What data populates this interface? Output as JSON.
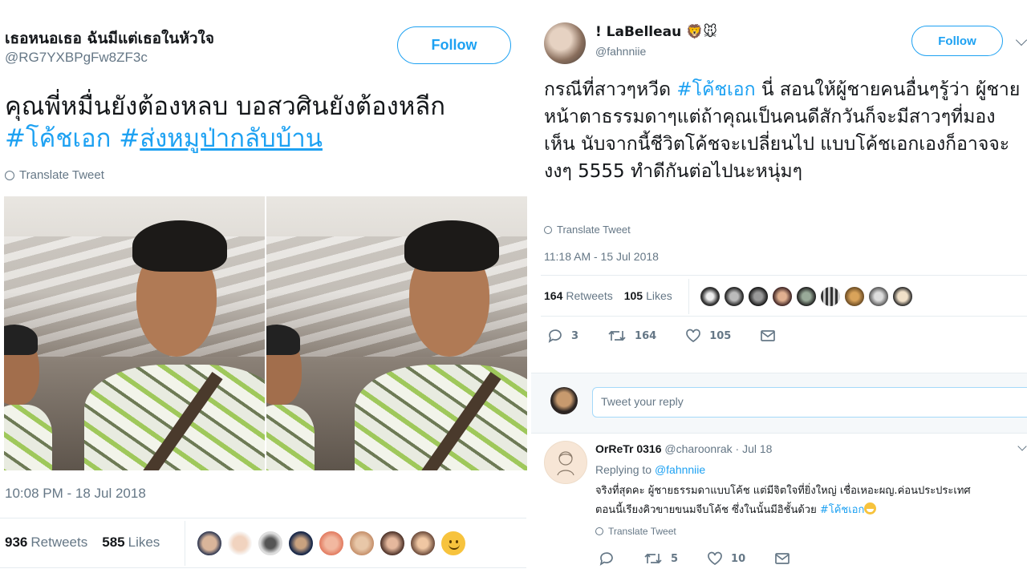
{
  "left_tweet": {
    "user_name": "เธอหนอเธอ ฉันมีแต่เธอในหัวใจ",
    "user_handle": "@RG7YXBPgFw8ZF3c",
    "follow_label": "Follow",
    "text_line1": "คุณพี่หมื่นยังต้องหลบ บอสวศินยังต้องหลีก",
    "hashtag1": "#โค้ชเอก",
    "hashtag2_prefix": "#",
    "hashtag2_link": "ส่งหมูป่ากลับบ้าน",
    "translate_label": "Translate Tweet",
    "timestamp": "10:08 PM - 18 Jul 2018",
    "retweets_count": "936",
    "retweets_label": "Retweets",
    "likes_count": "585",
    "likes_label": "Likes"
  },
  "right_tweet": {
    "user_name": "! LaBelleau 🦁🐭",
    "user_handle": "@fahnniie",
    "follow_label": "Follow",
    "text_before": "กรณีที่สาวๆหวีด ",
    "text_hashtag": "#โค้ชเอก",
    "text_after": " นี่ สอนให้ผู้ชายคนอื่นๆรู้ว่า ผู้ชายหน้าตาธรรมดาๆแต่ถ้าคุณเป็นคนดีสักวันก็จะมีสาวๆที่มองเห็น นับจากนี้ชีวิตโค้ชจะเปลี่ยนไป แบบโค้ชเอกเองก็อาจจะงงๆ 5555 ทำดีกันต่อไปนะหนุ่มๆ",
    "translate_label": "Translate Tweet",
    "timestamp": "11:18 AM - 15 Jul 2018",
    "retweets_count": "164",
    "retweets_label": "Retweets",
    "likes_count": "105",
    "likes_label": "Likes",
    "actions": {
      "reply_count": "3",
      "retweet_count": "164",
      "like_count": "105"
    }
  },
  "reply_box": {
    "placeholder": "Tweet your reply"
  },
  "reply": {
    "user_name": "OrReTr 0316",
    "user_handle": "@charoonrak",
    "date": "· Jul 18",
    "replying_prefix": "Replying to ",
    "replying_handle": "@fahnniie",
    "text_line1": "จริงที่สุดคะ ผู้ชายธรรมดาแบบโค้ช แต่มีจิตใจที่ยิ่งใหญ่ เชื่อเหอะผญ.ค่อนประประเทศ",
    "text_line2": "ตอนนี้เรียงคิวขายขนมจีบโค้ช ซึ่งในนั้นมีอิชั้นด้วย ",
    "text_hashtag": "#โค้ชเอก",
    "translate_label": "Translate Tweet",
    "actions": {
      "retweet_count": "5",
      "like_count": "10"
    }
  },
  "colors": {
    "accent": "#1da1f2",
    "muted": "#657786",
    "text": "#14171a",
    "border": "#e6ecf0"
  },
  "icons": [
    "globe-icon",
    "reply-icon",
    "retweet-icon",
    "like-icon",
    "message-icon",
    "chevron-down-icon"
  ]
}
